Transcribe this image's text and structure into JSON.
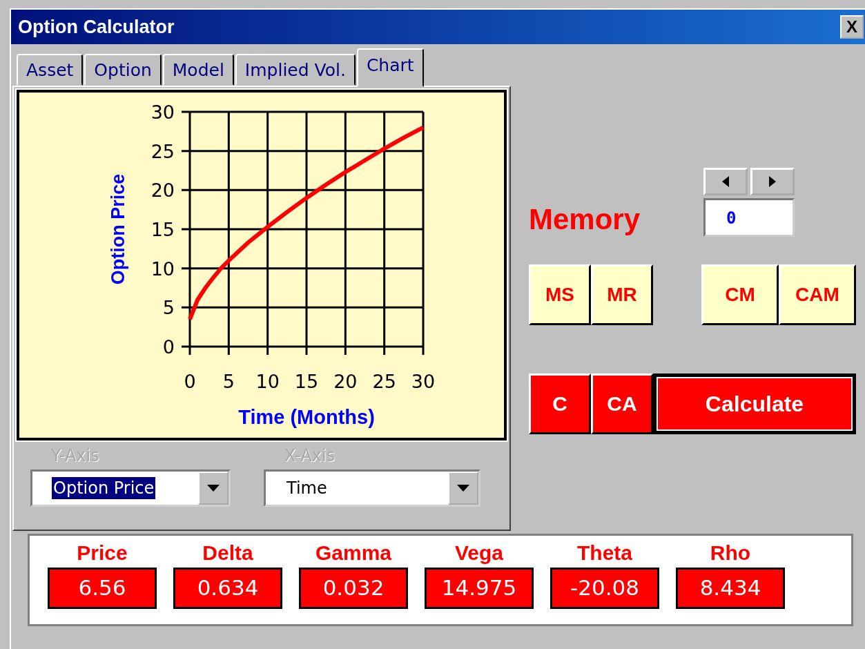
{
  "window": {
    "title": "Option Calculator",
    "close": "X"
  },
  "tabs": [
    {
      "label": "Asset",
      "selected": false
    },
    {
      "label": "Option",
      "selected": false
    },
    {
      "label": "Model",
      "selected": false
    },
    {
      "label": "Implied Vol.",
      "selected": false
    },
    {
      "label": "Chart",
      "selected": true
    }
  ],
  "chart": {
    "chart_data": {
      "type": "line",
      "xlabel": "Time (Months)",
      "ylabel": "Option Price",
      "x": [
        0,
        1,
        2,
        3,
        4,
        5,
        7.5,
        10,
        12.5,
        15,
        17.5,
        20,
        22.5,
        25,
        27.5,
        30
      ],
      "grid": true,
      "series": [
        {
          "color": "#ff0000",
          "values": [
            3.5,
            6,
            7.5,
            8.8,
            10,
            11,
            13.3,
            15.3,
            17.2,
            19,
            20.7,
            22.3,
            23.8,
            25.3,
            26.7,
            28
          ]
        }
      ],
      "xlim": [
        0,
        30
      ],
      "ylim": [
        0,
        30
      ],
      "xticks": [
        0,
        5,
        10,
        15,
        20,
        25,
        30
      ],
      "yticks": [
        0,
        5,
        10,
        15,
        20,
        25,
        30
      ]
    }
  },
  "axis_selectors": [
    {
      "label": "Y-Axis",
      "value": "Option Price",
      "highlighted": true
    },
    {
      "label": "X-Axis",
      "value": "Time",
      "highlighted": false
    }
  ],
  "memory": {
    "label": "Memory",
    "value": "0"
  },
  "memory_buttons": [
    "MS",
    "MR",
    "CM",
    "CAM"
  ],
  "clear_buttons": [
    "C",
    "CA"
  ],
  "calculate_button": "Calculate",
  "results": [
    {
      "label": "Price",
      "value": "6.56"
    },
    {
      "label": "Delta",
      "value": "0.634"
    },
    {
      "label": "Gamma",
      "value": "0.032"
    },
    {
      "label": "Vega",
      "value": "14.975"
    },
    {
      "label": "Theta",
      "value": "-20.08"
    },
    {
      "label": "Rho",
      "value": "8.434"
    }
  ]
}
